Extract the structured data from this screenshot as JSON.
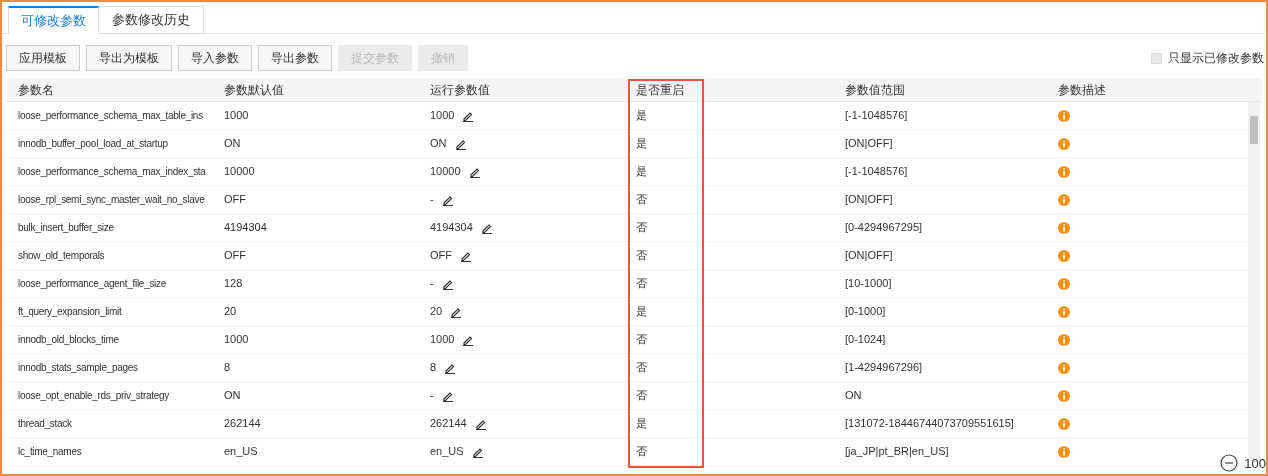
{
  "tabs": [
    {
      "label": "可修改参数",
      "selected": true
    },
    {
      "label": "参数修改历史",
      "selected": false
    }
  ],
  "toolbar": {
    "buttons": [
      {
        "label": "应用模板",
        "disabled": false
      },
      {
        "label": "导出为模板",
        "disabled": false
      },
      {
        "label": "导入参数",
        "disabled": false
      },
      {
        "label": "导出参数",
        "disabled": false
      },
      {
        "label": "提交参数",
        "disabled": true
      },
      {
        "label": "撤销",
        "disabled": true
      }
    ],
    "filter": {
      "label": "只显示已修改参数",
      "checked": false
    }
  },
  "table": {
    "columns": [
      {
        "label": "参数名",
        "highlighted": false
      },
      {
        "label": "参数默认值",
        "highlighted": false
      },
      {
        "label": "运行参数值",
        "highlighted": false
      },
      {
        "label": "是否重启",
        "highlighted": true
      },
      {
        "label": "参数值范围",
        "highlighted": false
      },
      {
        "label": "参数描述",
        "highlighted": false
      }
    ],
    "rows": [
      {
        "name": "loose_performance_schema_max_table_ins",
        "default": "1000",
        "running": "1000",
        "restart": "是",
        "range": "[-1-1048576]"
      },
      {
        "name": "innodb_buffer_pool_load_at_startup",
        "default": "ON",
        "running": "ON",
        "restart": "是",
        "range": "[ON|OFF]"
      },
      {
        "name": "loose_performance_schema_max_index_sta",
        "default": "10000",
        "running": "10000",
        "restart": "是",
        "range": "[-1-1048576]"
      },
      {
        "name": "loose_rpl_semi_sync_master_wait_no_slave",
        "default": "OFF",
        "running": "-",
        "restart": "否",
        "range": "[ON|OFF]"
      },
      {
        "name": "bulk_insert_buffer_size",
        "default": "4194304",
        "running": "4194304",
        "restart": "否",
        "range": "[0-4294967295]"
      },
      {
        "name": "show_old_temporals",
        "default": "OFF",
        "running": "OFF",
        "restart": "否",
        "range": "[ON|OFF]"
      },
      {
        "name": "loose_performance_agent_file_size",
        "default": "128",
        "running": "-",
        "restart": "否",
        "range": "[10-1000]"
      },
      {
        "name": "ft_query_expansion_limit",
        "default": "20",
        "running": "20",
        "restart": "是",
        "range": "[0-1000]"
      },
      {
        "name": "innodb_old_blocks_time",
        "default": "1000",
        "running": "1000",
        "restart": "否",
        "range": "[0-1024]"
      },
      {
        "name": "innodb_stats_sample_pages",
        "default": "8",
        "running": "8",
        "restart": "否",
        "range": "[1-4294967296]"
      },
      {
        "name": "loose_opt_enable_rds_priv_strategy",
        "default": "ON",
        "running": "-",
        "restart": "否",
        "range": "ON"
      },
      {
        "name": "thread_stack",
        "default": "262144",
        "running": "262144",
        "restart": "是",
        "range": "[131072-18446744073709551615]"
      },
      {
        "name": "lc_time_names",
        "default": "en_US",
        "running": "en_US",
        "restart": "否",
        "range": "[ja_JP|pt_BR|en_US]"
      }
    ]
  },
  "zoom": {
    "reading": "100"
  }
}
